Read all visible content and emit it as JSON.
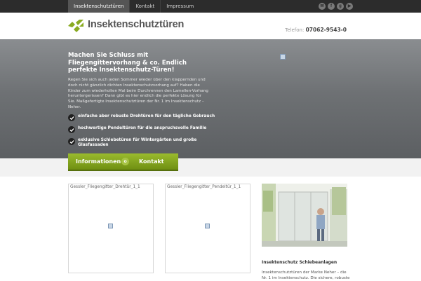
{
  "topnav": {
    "items": [
      {
        "label": "Insektenschutztüren",
        "active": true
      },
      {
        "label": "Kontakt",
        "active": false
      },
      {
        "label": "Impressum",
        "active": false
      }
    ],
    "social_icons": [
      "email-icon",
      "facebook-icon",
      "google-plus-icon",
      "youtube-icon"
    ]
  },
  "header": {
    "logo_text": "Insektenschutztüren",
    "phone_label": "Telefon:",
    "phone_number": "07062-9543-0"
  },
  "hero": {
    "title": "Machen Sie Schluss mit Fliegengittervorhang & co. Endlich perfekte Insektenschutz-Türen!",
    "intro": "Regen Sie sich auch jeden Sommer wieder über den klappernden und doch nicht gänzlich dichten Insektenschutzvorhang auf? Haben die Kinder zum wiederholten Mal beim Durchrennen den Lamellen-Vorhang heruntergerissen? Dann gibt es hier endlich die perfekte Lösung für Sie. Maßgefertigte Insektenschutztüren der Nr. 1 im Insektenschutz – Neher.",
    "bullets": [
      "einfache aber robuste Drehtüren für den tägliche Gebrauch",
      "hochwertige Pendeltüren für die anspruchsvolle Familie",
      "exklusive Schiebetüren für Wintergärten und große Glasfassaden"
    ]
  },
  "tabs": {
    "info": "Informationen",
    "dot": "o",
    "kontakt": "Kontakt"
  },
  "gallery": [
    {
      "caption": "Gessler_Fliegengitter_Drehtür_1_1"
    },
    {
      "caption": "Gessler_Fliegengitter_Pendeltür_1_1"
    }
  ],
  "side": {
    "title": "Insektenschutz Schiebeanlagen",
    "text": "Insektenschutztüren der Marke Neher – die Nr. 1 im Insektenschutz. Die sichere, robuste"
  },
  "colors": {
    "topbar": "#2c2c2c",
    "accent_green": "#8aab22",
    "hero_gray": "#6e7174"
  }
}
